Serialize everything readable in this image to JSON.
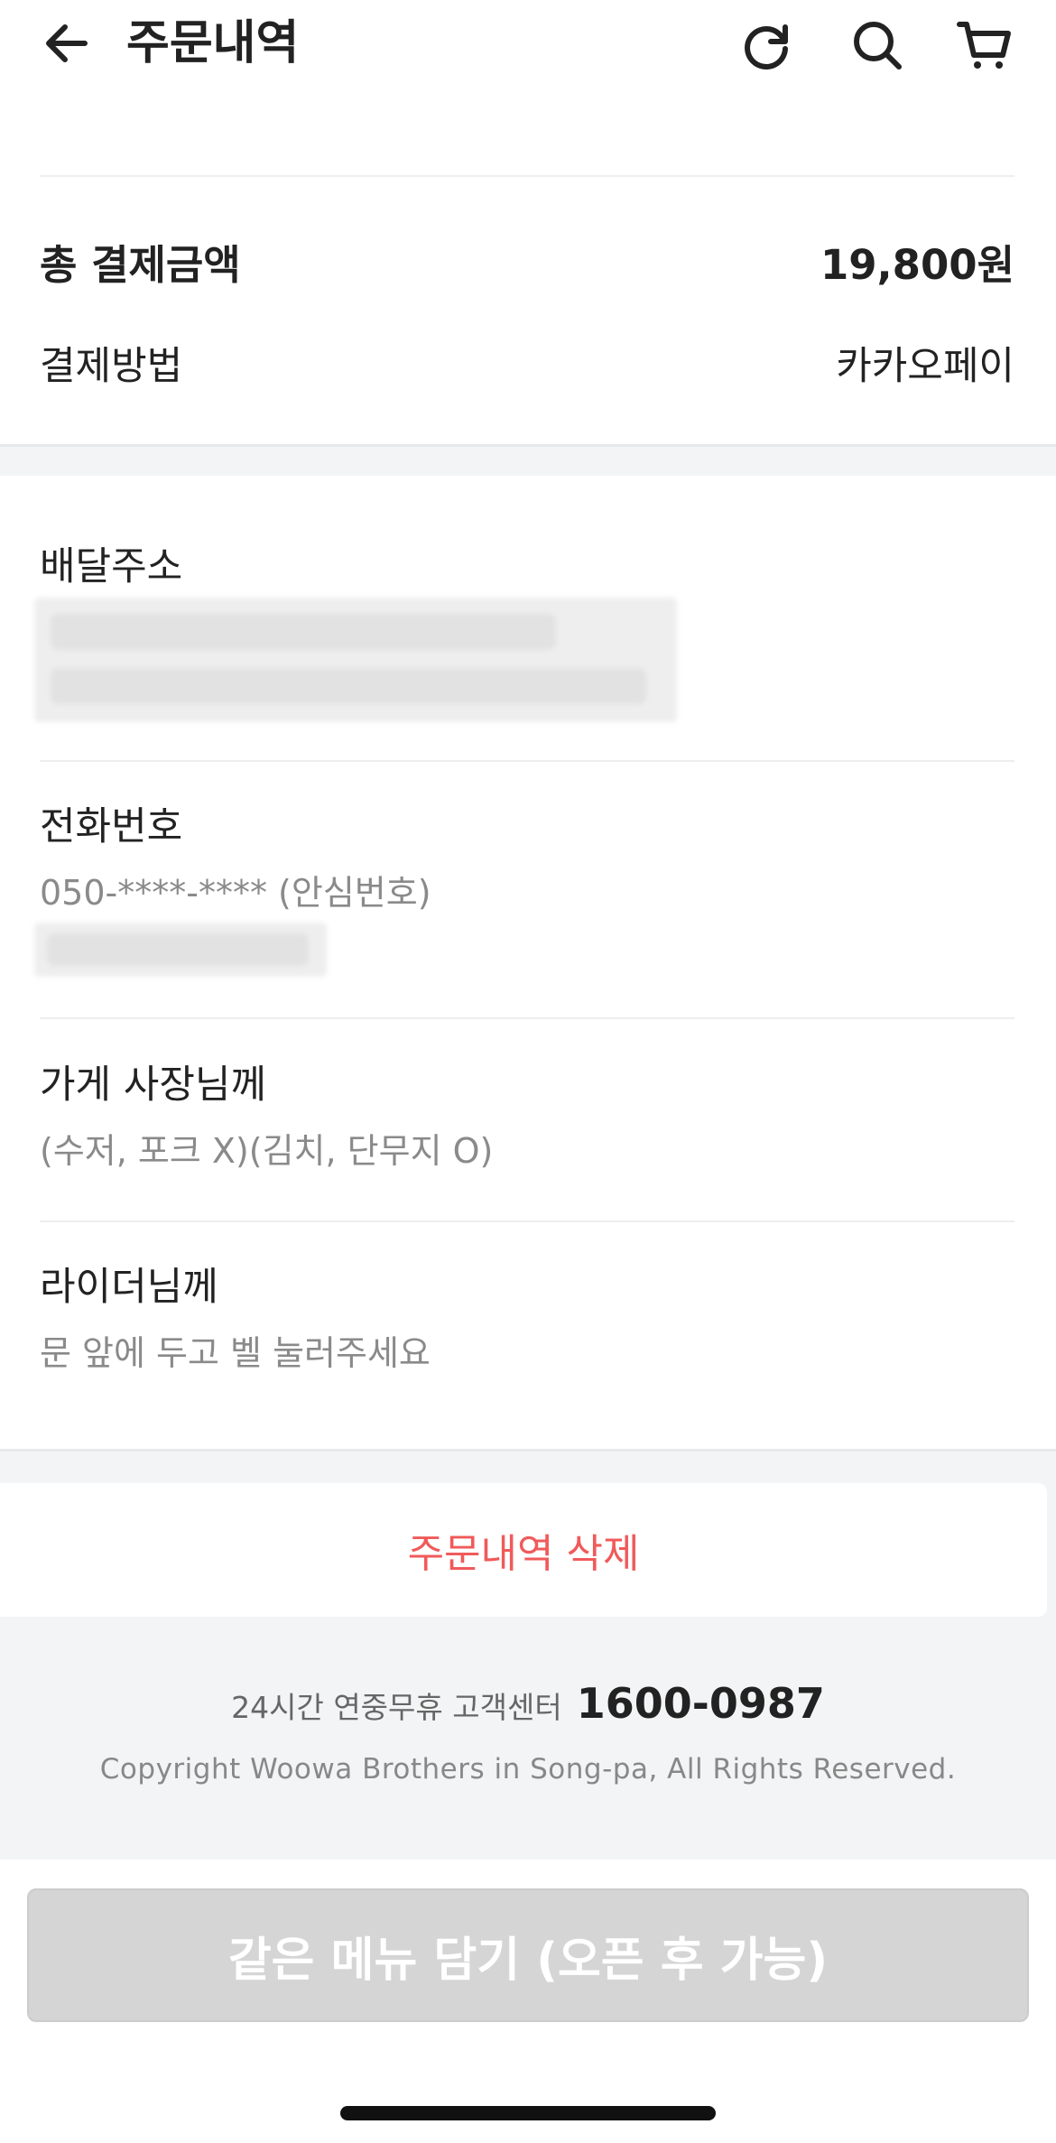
{
  "header": {
    "title": "주문내역",
    "icons": [
      "back-arrow-icon",
      "refresh-icon",
      "search-icon",
      "cart-icon"
    ]
  },
  "payment": {
    "total_label": "총 결제금액",
    "total_value": "19,800원",
    "method_label": "결제방법",
    "method_value": "카카오페이"
  },
  "delivery": {
    "address_label": "배달주소",
    "phone_label": "전화번호",
    "phone_value": "050-****-**** (안심번호)",
    "store_note_label": "가게 사장님께",
    "store_note_value": "(수저, 포크 X)(김치, 단무지 O)",
    "rider_note_label": "라이더님께",
    "rider_note_value": "문 앞에 두고 벨 눌러주세요"
  },
  "actions": {
    "delete_label": "주문내역 삭제",
    "reorder_label": "같은 메뉴 담기 (오픈 후 가능)"
  },
  "footer": {
    "cs_label": "24시간 연중무휴 고객센터",
    "cs_phone": "1600-0987",
    "copyright": "Copyright Woowa Brothers in Song-pa, All Rights Reserved."
  },
  "colors": {
    "delete_red": "#f05a5a",
    "band_gray": "#f3f4f5",
    "disabled_button": "#d5d5d5"
  }
}
